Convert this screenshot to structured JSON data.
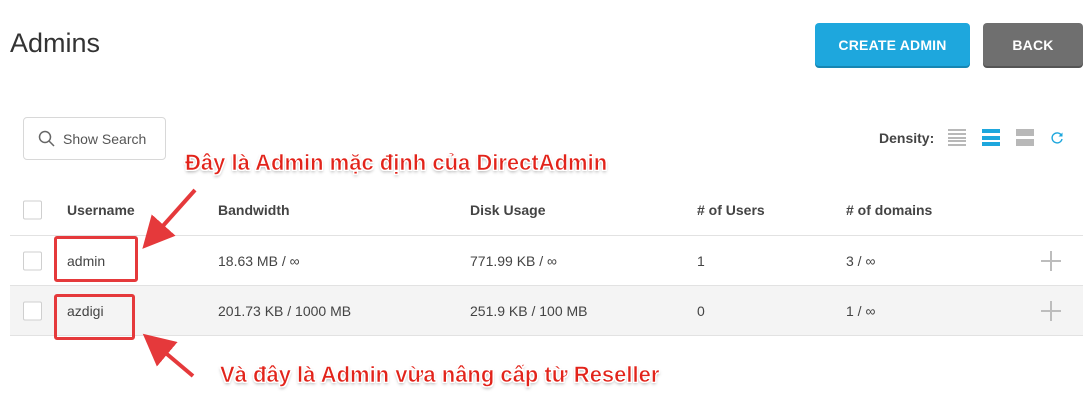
{
  "page": {
    "title": "Admins"
  },
  "actions": {
    "create_label": "CREATE ADMIN",
    "back_label": "BACK"
  },
  "search": {
    "label": "Show Search"
  },
  "density": {
    "label": "Density:",
    "selected": "normal"
  },
  "table": {
    "headers": {
      "username": "Username",
      "bandwidth": "Bandwidth",
      "disk": "Disk Usage",
      "users": "# of Users",
      "domains": "# of domains"
    },
    "rows": [
      {
        "username": "admin",
        "bandwidth": "18.63 MB / ∞",
        "disk": "771.99 KB / ∞",
        "users": "1",
        "domains": "3 / ∞"
      },
      {
        "username": "azdigi",
        "bandwidth": "201.73 KB / 1000 MB",
        "disk": "251.9 KB / 100 MB",
        "users": "0",
        "domains": "1 / ∞"
      }
    ]
  },
  "annotations": {
    "note_default_admin": "Đây là Admin mặc định của DirectAdmin",
    "note_upgraded_admin": "Và đây là Admin vừa nâng cấp từ Reseller",
    "color": "#e5393b"
  },
  "colors": {
    "accent": "#1ea7dd",
    "back": "#6f6f6f"
  }
}
